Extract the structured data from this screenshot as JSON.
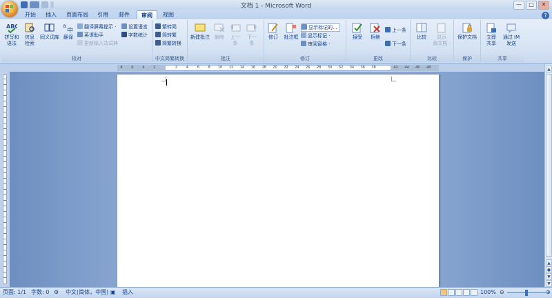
{
  "window": {
    "title": "文档 1 - Microsoft Word",
    "controls": [
      "—",
      "□",
      "✕"
    ]
  },
  "tabs": [
    {
      "label": "开始"
    },
    {
      "label": "插入"
    },
    {
      "label": "页面布局"
    },
    {
      "label": "引用"
    },
    {
      "label": "邮件"
    },
    {
      "label": "审阅",
      "active": true
    },
    {
      "label": "视图"
    }
  ],
  "ribbon": {
    "proofing": {
      "label": "校对",
      "spelling_line1": "拼写和",
      "spelling_line2": "语法",
      "research_line1": "信息",
      "research_line2": "检索",
      "thesaurus": "同义词库",
      "translate": "翻译",
      "screentip": "翻译屏幕提示 ·",
      "english_assist": "英语助手",
      "update_ime": "更新输入法词典",
      "set_language": "设置语言",
      "word_count": "字数统计"
    },
    "chinese_conversion": {
      "label": "中文简繁转换",
      "to_simplified": "繁转简",
      "to_traditional": "简转繁",
      "conversion": "简繁转换"
    },
    "comments": {
      "label": "批注",
      "new_comment": "新建批注",
      "delete": "删除",
      "previous_line1": "上一",
      "previous_line2": "条",
      "next_line1": "下一",
      "next_line2": "条"
    },
    "tracking": {
      "label": "修订",
      "track_changes": "修订",
      "balloons": "批注框",
      "display_markup": "显示标记的...",
      "show_markup": "显示标记 ·",
      "reviewing_pane": "审阅窗格 ·"
    },
    "changes": {
      "label": "更改",
      "accept": "接受",
      "reject": "拒绝",
      "previous": "上一条",
      "next": "下一条"
    },
    "compare": {
      "label": "比较",
      "compare": "比较",
      "show_source_line1": "显示",
      "show_source_line2": "源文档 ·"
    },
    "protect": {
      "label": "保护",
      "protect_document": "保护文档"
    },
    "share": {
      "label": "共享",
      "share_now_line1": "立即",
      "share_now_line2": "共享",
      "send_im_line1": "通过 IM",
      "send_im_line2": "发送"
    }
  },
  "ruler": {
    "numbers": [
      "8",
      "6",
      "4",
      "2",
      "",
      "2",
      "4",
      "6",
      "8",
      "10",
      "12",
      "14",
      "16",
      "18",
      "20",
      "22",
      "24",
      "26",
      "28",
      "30",
      "32",
      "34",
      "36",
      "38",
      "",
      "42",
      "44",
      "46",
      "48"
    ]
  },
  "statusbar": {
    "page": "页面: 1/1",
    "words": "字数: 0",
    "language": "中文(简体，中国)",
    "mode": "插入",
    "zoom": "100%",
    "zoom_minus": "⊖",
    "zoom_plus": "⊕"
  },
  "colors": {
    "accent": "#15428b",
    "ribbon": "#dbe6f5",
    "workspace": "#8eaad4"
  }
}
